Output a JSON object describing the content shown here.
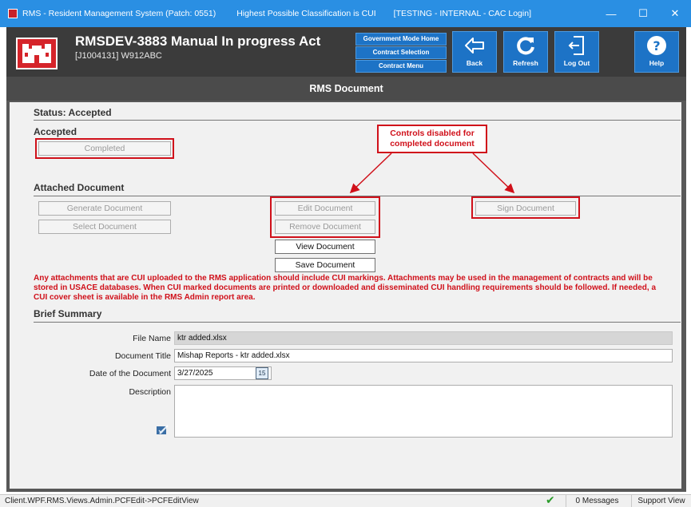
{
  "window": {
    "title": "RMS - Resident Management System (Patch: 0551)",
    "classification": "Highest Possible Classification is CUI",
    "environment": "[TESTING - INTERNAL - CAC Login]",
    "minimize": "—",
    "maximize": "☐",
    "close": "✕"
  },
  "header": {
    "title": "RMSDEV-3883 Manual In progress Act",
    "subtitle": "[J1004131] W912ABC",
    "nav": [
      "Government Mode Home",
      "Contract Selection",
      "Contract Menu"
    ],
    "buttons": {
      "back": "Back",
      "refresh": "Refresh",
      "logout": "Log Out",
      "help": "Help"
    }
  },
  "page_title": "RMS Document",
  "status": {
    "heading": "Status: Accepted",
    "label": "Accepted",
    "button": "Completed"
  },
  "callout": {
    "text": "Controls disabled for completed document",
    "color": "#d0101a"
  },
  "attached": {
    "heading": "Attached Document",
    "generate": "Generate Document",
    "select": "Select Document",
    "edit": "Edit Document",
    "remove": "Remove Document",
    "view": "View Document",
    "save": "Save Document",
    "sign": "Sign Document"
  },
  "warning": "Any attachments that are CUI uploaded to the RMS application should include CUI markings.  Attachments may be used in the management of contracts and will be stored in USACE databases.  When CUI marked documents are printed or downloaded and disseminated CUI handling requirements should be followed. If needed, a CUI cover sheet is available in the RMS Admin report area.",
  "summary": {
    "heading": "Brief Summary",
    "file_name_label": "File Name",
    "file_name": "ktr added.xlsx",
    "doc_title_label": "Document Title",
    "doc_title": "Mishap Reports - ktr added.xlsx",
    "date_label": "Date of the Document",
    "date": "3/27/2025",
    "calendar_day": "15",
    "description_label": "Description",
    "description": ""
  },
  "statusbar": {
    "path": "Client.WPF.RMS.Views.Admin.PCFEdit->PCFEditView",
    "messages": "0 Messages",
    "support": "Support View"
  },
  "colors": {
    "titlebar": "#2a8fe3",
    "header": "#3b3b3b",
    "nav_blue": "#1d73c6",
    "highlight_red": "#d0101a",
    "logo_red": "#d5242a"
  }
}
